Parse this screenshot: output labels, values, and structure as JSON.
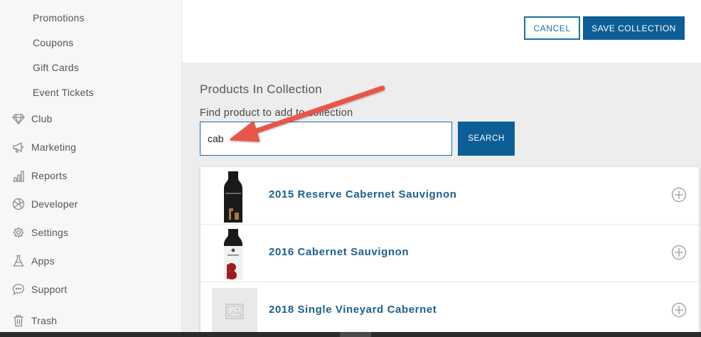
{
  "sidebar": {
    "sub_items": [
      "Promotions",
      "Coupons",
      "Gift Cards",
      "Event Tickets"
    ],
    "items": [
      {
        "label": "Club",
        "icon": "diamond-icon"
      },
      {
        "label": "Marketing",
        "icon": "megaphone-icon"
      },
      {
        "label": "Reports",
        "icon": "bar-chart-icon"
      },
      {
        "label": "Developer",
        "icon": "aperture-icon"
      },
      {
        "label": "Settings",
        "icon": "gear-icon"
      },
      {
        "label": "Apps",
        "icon": "flask-icon"
      },
      {
        "label": "Support",
        "icon": "chat-bubble-icon"
      },
      {
        "label": "Trash",
        "icon": "trash-icon"
      }
    ]
  },
  "toolbar": {
    "cancel_label": "CANCEL",
    "save_label": "SAVE COLLECTION"
  },
  "products_section": {
    "title": "Products In Collection",
    "find_label": "Find product to add to collection",
    "search_value": "cab",
    "search_button": "SEARCH"
  },
  "results": [
    {
      "name": "2015 Reserve Cabernet Sauvignon",
      "thumb": "wine-bottle-image"
    },
    {
      "name": "2016 Cabernet Sauvignon",
      "thumb": "wine-bottle-image"
    },
    {
      "name": "2018 Single Vineyard Cabernet",
      "thumb": "image-placeholder-icon"
    }
  ],
  "colors": {
    "accent": "#0d5e96",
    "link": "#1d5f8e",
    "annotation_arrow": "#e8574a"
  }
}
